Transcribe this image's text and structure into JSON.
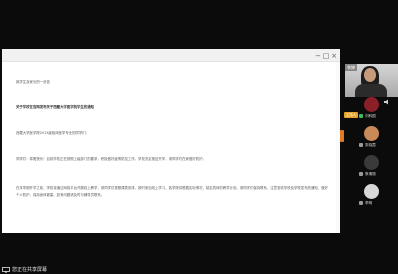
{
  "document": {
    "lines": [
      "致学生及家长的一封信",
      "关于学校在官网发布关于西藏大学医学院学生的通知",
      "西藏大学医学院2015级临床医学专业的同学们：",
      "同学们：寒假快乐！目前学校正在按照上级部门的要求，积极做好疫情防控工作。学校决定推迟开学，请同学们在家做好防护。"
    ],
    "paragraph": "在本学期开学之前，学校将通过网络平台开展线上教学，请同学们按照课表安排，按时参加线上学习。各学院将根据实际情况，制定具体的教学计划。请同学们保持联系，注意查收学校及学院发布的通知，做好个人防护，保持身体健康。如有问题请及时与辅导员联系。"
  },
  "participants": {
    "video": {
      "name": "李婷",
      "host_badge": "主持人"
    },
    "list": [
      {
        "name": "刘科国",
        "avatar_color": "#8a1f28",
        "mic_active": true
      },
      {
        "name": "张晓霞",
        "avatar_color": "#c98a5a",
        "mic_active": false
      },
      {
        "name": "蔡清丽",
        "avatar_color": "#3a3a3a",
        "mic_active": false
      },
      {
        "name": "李明",
        "avatar_color": "#d7d7d7",
        "mic_active": false
      }
    ]
  },
  "bottom_bar": {
    "share_text": "您正在共享屏幕"
  },
  "colors": {
    "accent_orange": "#e07a1f",
    "host_badge": "#e5a227",
    "mic_active": "#3dbb5d"
  }
}
